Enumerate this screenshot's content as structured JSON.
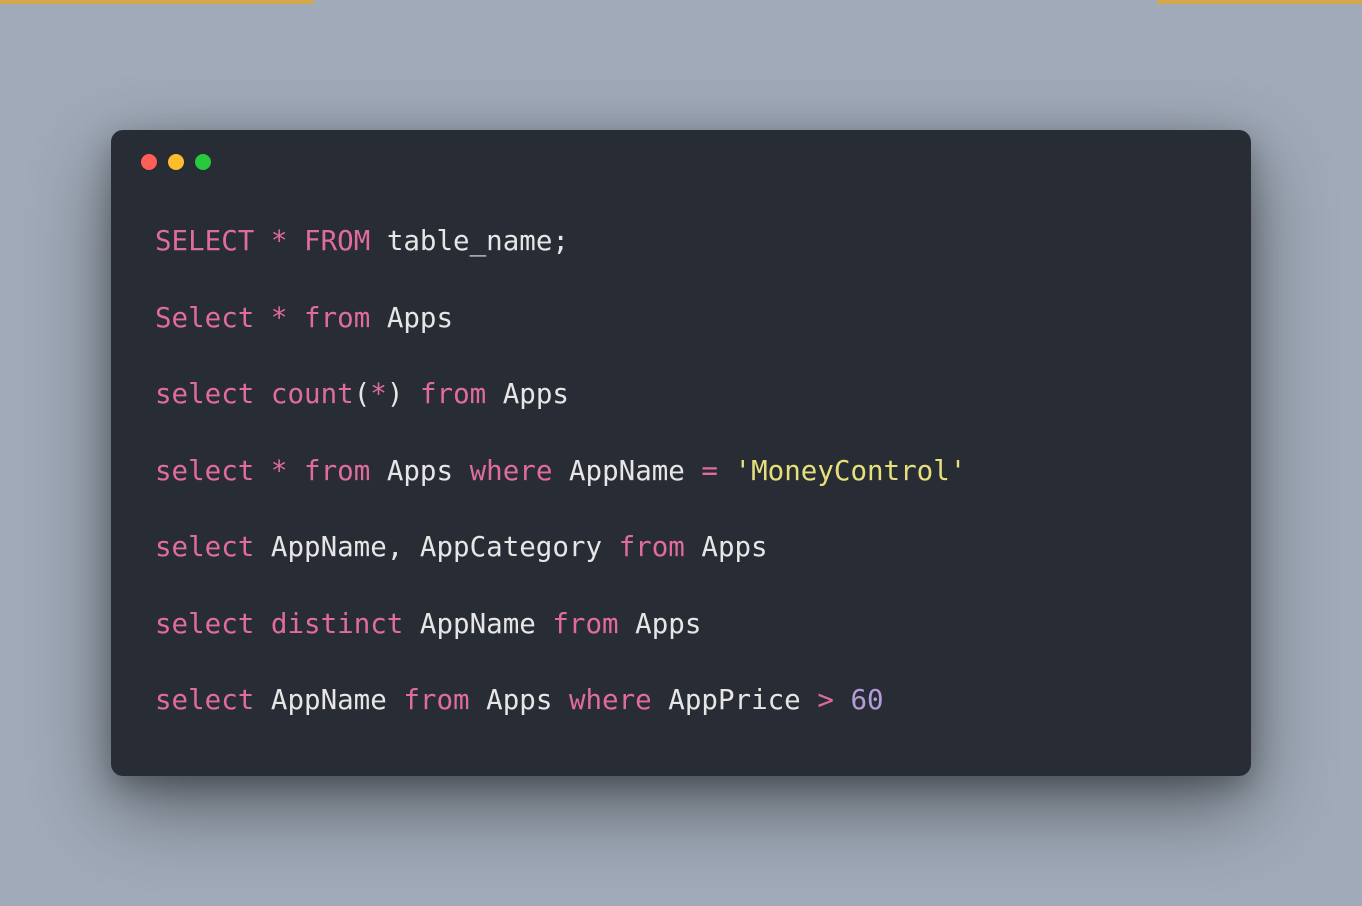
{
  "code": {
    "lines": [
      {
        "tokens": [
          {
            "type": "kw",
            "text": "SELECT"
          },
          {
            "type": "txt",
            "text": " "
          },
          {
            "type": "op",
            "text": "*"
          },
          {
            "type": "txt",
            "text": " "
          },
          {
            "type": "kw",
            "text": "FROM"
          },
          {
            "type": "txt",
            "text": " table_name;"
          }
        ]
      },
      {
        "tokens": [
          {
            "type": "kw",
            "text": "Select"
          },
          {
            "type": "txt",
            "text": " "
          },
          {
            "type": "op",
            "text": "*"
          },
          {
            "type": "txt",
            "text": " "
          },
          {
            "type": "kw",
            "text": "from"
          },
          {
            "type": "txt",
            "text": " Apps"
          }
        ]
      },
      {
        "tokens": [
          {
            "type": "kw",
            "text": "select"
          },
          {
            "type": "txt",
            "text": " "
          },
          {
            "type": "fn",
            "text": "count"
          },
          {
            "type": "txt",
            "text": "("
          },
          {
            "type": "op",
            "text": "*"
          },
          {
            "type": "txt",
            "text": ") "
          },
          {
            "type": "kw",
            "text": "from"
          },
          {
            "type": "txt",
            "text": " Apps"
          }
        ]
      },
      {
        "tokens": [
          {
            "type": "kw",
            "text": "select"
          },
          {
            "type": "txt",
            "text": " "
          },
          {
            "type": "op",
            "text": "*"
          },
          {
            "type": "txt",
            "text": " "
          },
          {
            "type": "kw",
            "text": "from"
          },
          {
            "type": "txt",
            "text": " Apps "
          },
          {
            "type": "kw",
            "text": "where"
          },
          {
            "type": "txt",
            "text": " AppName "
          },
          {
            "type": "op",
            "text": "="
          },
          {
            "type": "txt",
            "text": " "
          },
          {
            "type": "str",
            "text": "'MoneyControl'"
          }
        ]
      },
      {
        "tokens": [
          {
            "type": "kw",
            "text": "select"
          },
          {
            "type": "txt",
            "text": " AppName, AppCategory "
          },
          {
            "type": "kw",
            "text": "from"
          },
          {
            "type": "txt",
            "text": " Apps"
          }
        ]
      },
      {
        "tokens": [
          {
            "type": "kw",
            "text": "select"
          },
          {
            "type": "txt",
            "text": " "
          },
          {
            "type": "kw",
            "text": "distinct"
          },
          {
            "type": "txt",
            "text": " AppName "
          },
          {
            "type": "kw",
            "text": "from"
          },
          {
            "type": "txt",
            "text": " Apps"
          }
        ]
      },
      {
        "tokens": [
          {
            "type": "kw",
            "text": "select"
          },
          {
            "type": "txt",
            "text": " AppName "
          },
          {
            "type": "kw",
            "text": "from"
          },
          {
            "type": "txt",
            "text": " Apps "
          },
          {
            "type": "kw",
            "text": "where"
          },
          {
            "type": "txt",
            "text": " AppPrice "
          },
          {
            "type": "op",
            "text": ">"
          },
          {
            "type": "txt",
            "text": " "
          },
          {
            "type": "num",
            "text": "60"
          }
        ]
      }
    ]
  },
  "window": {
    "controls": [
      "red",
      "yellow",
      "green"
    ]
  }
}
